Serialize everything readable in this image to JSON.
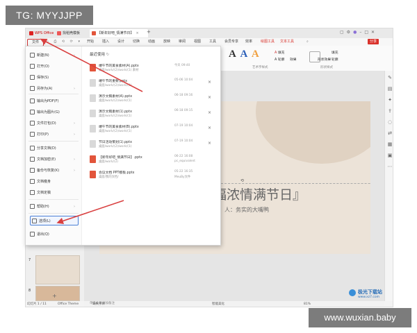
{
  "watermark": {
    "top": "TG: MYYJJPP",
    "bottom": "www.wuxian.baby"
  },
  "titlebar": {
    "tabs": [
      {
        "label": "WPS Office"
      },
      {
        "label": "找稻壳模板"
      },
      {
        "label": "【新年好吧_情满节日】"
      }
    ],
    "new_tab": "+"
  },
  "menubar": {
    "file": "文件",
    "items": [
      "开始",
      "插入",
      "设计",
      "切换",
      "动画",
      "放映",
      "审阅",
      "视图",
      "工具",
      "会员专享",
      "效率",
      "绘图工具",
      "文本工具"
    ],
    "share": "分享"
  },
  "ribbon": {
    "fill_label": "填充",
    "outline_label": "轮廓",
    "effect_label": "效果",
    "text_style_label": "艺术字样式",
    "shape_style_label": "形状样式",
    "shape_fill": "填充",
    "shape_outline": "轮廓",
    "shape_effect": "形状效果"
  },
  "file_menu": {
    "items": [
      {
        "label": "新建(N)",
        "arrow": true
      },
      {
        "label": "打开(O)",
        "arrow": false
      },
      {
        "label": "保存(S)",
        "arrow": false
      },
      {
        "label": "另存为(A)",
        "arrow": true
      },
      {
        "label": "输出为PDF(F)",
        "arrow": false
      },
      {
        "label": "输出为图片(G)",
        "arrow": false
      },
      {
        "label": "文件打包(D)",
        "arrow": true
      },
      {
        "label": "打印(P)",
        "arrow": true
      },
      {
        "label": "分享文档(D)",
        "arrow": false
      },
      {
        "label": "文档加密(E)",
        "arrow": true
      },
      {
        "label": "备份与恢复(K)",
        "arrow": true
      },
      {
        "label": "文档瘦身",
        "arrow": false
      },
      {
        "label": "文档定稿",
        "arrow": false
      },
      {
        "label": "帮助(H)",
        "arrow": true
      },
      {
        "label": "选项(L)",
        "arrow": false
      },
      {
        "label": "退出(Q)",
        "arrow": false
      }
    ],
    "recent_title": "最近使用",
    "recent": [
      {
        "name": "端午节的美食素材(A).pptx",
        "path": "桌面/work/(2)/work/(1) 素材",
        "time": "今天 09:40",
        "close": false,
        "red": true
      },
      {
        "name": "端午节的重要.pptx",
        "path": "桌面/work/(2)/work/(1)",
        "time": "05-06 10:04",
        "close": true,
        "red": false
      },
      {
        "name": "演示文稿素材(A).pptx",
        "path": "桌面/work/(2)/work/(1)",
        "time": "06-18 09:16",
        "close": true,
        "red": false
      },
      {
        "name": "演示文稿素材(1).pptx",
        "path": "桌面/work/(2)/work/(1)",
        "time": "06-18 09:15",
        "close": true,
        "red": false
      },
      {
        "name": "端午节的美食素材(B).pptx",
        "path": "桌面/work/(2)/work/(1)",
        "time": "07-19 10:04",
        "close": true,
        "red": false
      },
      {
        "name": "节日活动策划(1).pptx",
        "path": "桌面/work/(2)/work/(1)",
        "time": "07-19 10:04",
        "close": true,
        "red": false
      },
      {
        "name": "【新年好吧_情满节日】.pptx",
        "path": "桌面/work/(2)",
        "time": "06-22 16:08",
        "time2": "pc_equivalent",
        "close": false,
        "red": true
      },
      {
        "name": "会议文档 PPT模板.pptx",
        "path": "桌面/我的文档/",
        "time": "05-22 16:35",
        "time2": "MeuBy文件",
        "close": false,
        "red": true
      }
    ]
  },
  "slide": {
    "title": "祝福浓情满节日』",
    "subtitle": "人：务实的大嘴鸭"
  },
  "thumbs": {
    "numbers": [
      "7",
      "8"
    ]
  },
  "notes": "单击此处添加备注",
  "statusbar": {
    "page": "幻灯片 1 / 11",
    "theme": "Office Theme",
    "font": "缺失字体",
    "smart": "智能美化",
    "zoom": "81%"
  },
  "site_logo": {
    "text": "极光下载站",
    "sub": "www.xz7.com"
  },
  "colors": {
    "accent_red": "#d9322b",
    "arrow_red": "#d94040",
    "options_blue": "#4a7fd6"
  }
}
